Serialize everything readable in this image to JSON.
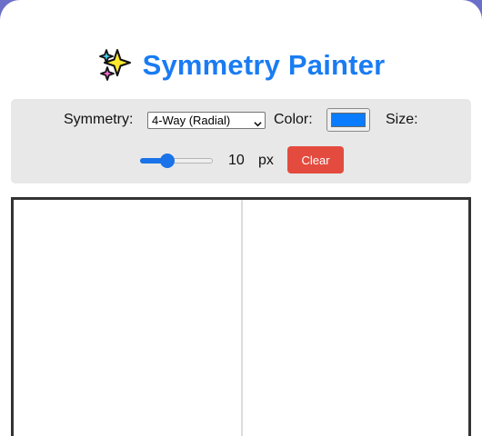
{
  "app": {
    "title": "Symmetry Painter",
    "title_icon": "sparkles-icon",
    "accent_color": "#1a7cf2"
  },
  "controls": {
    "symmetry_label": "Symmetry:",
    "symmetry_value": "4-Way (Radial)",
    "color_label": "Color:",
    "color_value": "#0a7cff",
    "size_label": "Size:",
    "size_value": "10",
    "size_unit": "px",
    "size_level_fraction": 0.33,
    "clear_label": "Clear",
    "clear_color": "#e44b3f"
  },
  "canvas": {
    "guide": "vertical-center-line"
  }
}
